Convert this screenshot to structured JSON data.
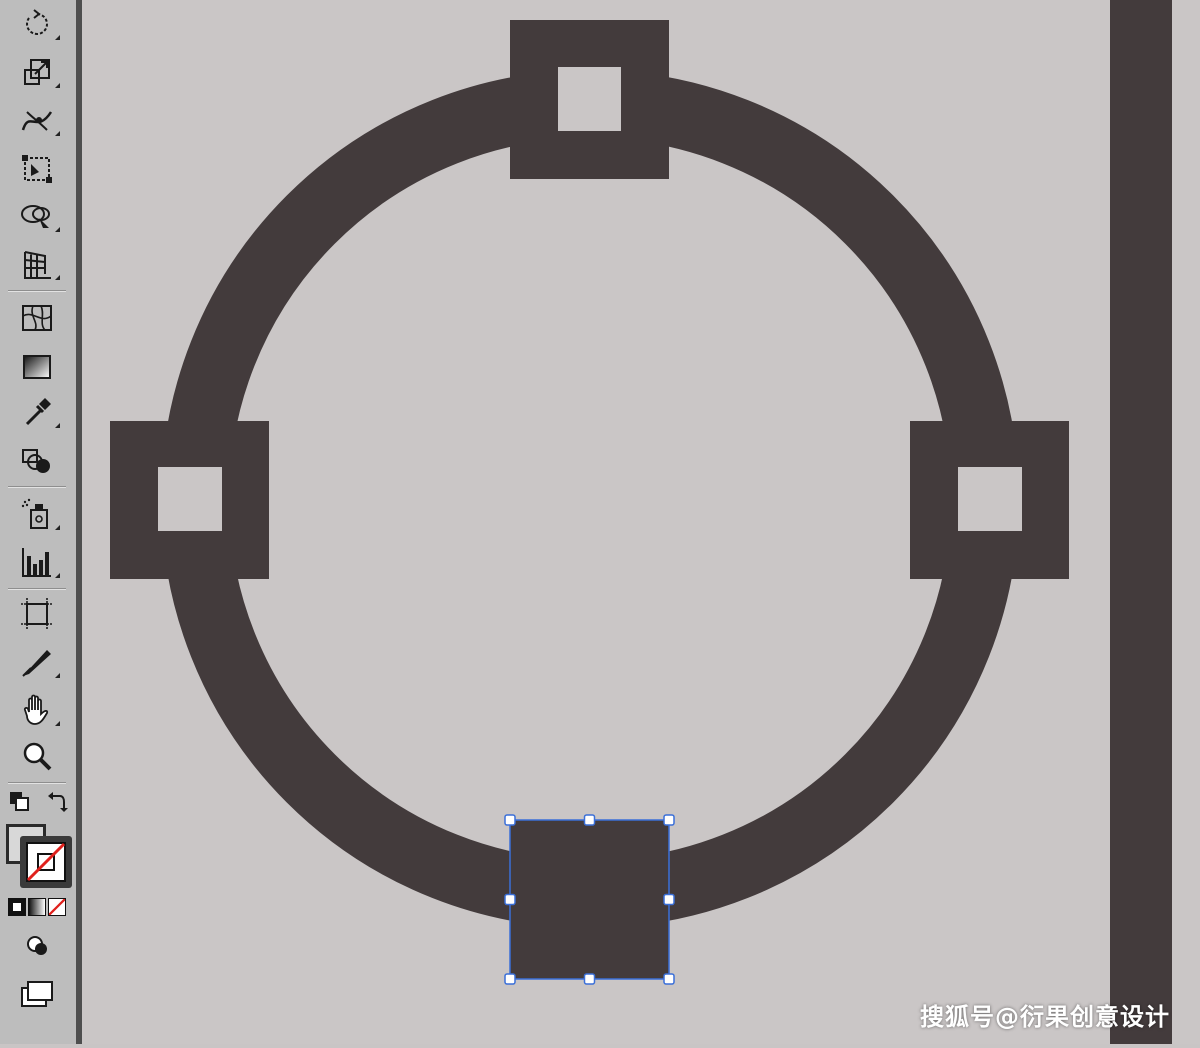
{
  "toolbar": {
    "tools": [
      {
        "icon": "rotate-icon"
      },
      {
        "icon": "scale-icon"
      },
      {
        "icon": "warp-icon"
      },
      {
        "icon": "free-transform-icon"
      },
      {
        "icon": "shape-builder-icon"
      },
      {
        "icon": "perspective-grid-icon"
      },
      {
        "icon": "mesh-icon"
      },
      {
        "icon": "gradient-icon"
      },
      {
        "icon": "eyedropper-icon"
      },
      {
        "icon": "blend-icon"
      },
      {
        "icon": "symbol-sprayer-icon"
      },
      {
        "icon": "column-graph-icon"
      },
      {
        "icon": "artboard-icon"
      },
      {
        "icon": "slice-icon"
      },
      {
        "icon": "hand-icon"
      },
      {
        "icon": "zoom-icon"
      }
    ],
    "fill_stroke": {
      "fill": "none",
      "stroke": "none"
    },
    "colors": {
      "icon": "#1a1a1a",
      "none_slash": "#e0201c"
    }
  },
  "canvas": {
    "background": "#cac6c6",
    "shape_color": "#433b3c",
    "selection_color": "#3a6fd8"
  },
  "watermark": {
    "text": "搜狐号@衍果创意设计"
  }
}
